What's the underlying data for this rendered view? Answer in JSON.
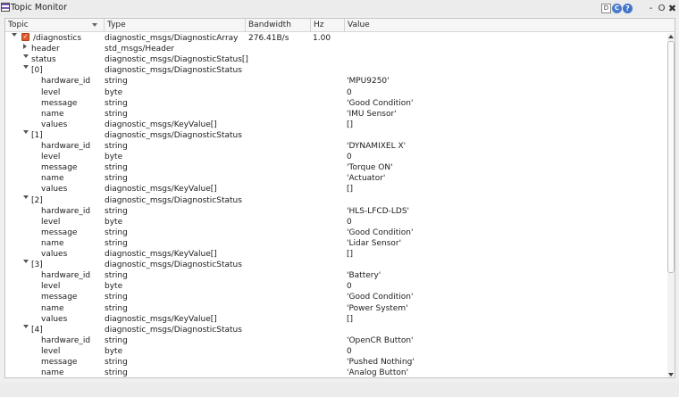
{
  "window": {
    "title": "Topic Monitor",
    "buttons": {
      "d": "D",
      "c": "C",
      "help": "?",
      "minimize": "-",
      "restore": "O",
      "close": "✖"
    }
  },
  "columns": {
    "topic": "Topic",
    "type": "Type",
    "bandwidth": "Bandwidth",
    "hz": "Hz",
    "value": "Value"
  },
  "rows": [
    {
      "depth": 0,
      "expander": "down",
      "checked": true,
      "label": "/diagnostics",
      "type": "diagnostic_msgs/DiagnosticArray",
      "bandwidth": "276.41B/s",
      "hz": "1.00",
      "value": ""
    },
    {
      "depth": 1,
      "expander": "right",
      "label": "header",
      "type": "std_msgs/Header",
      "value": ""
    },
    {
      "depth": 1,
      "expander": "down",
      "label": "status",
      "type": "diagnostic_msgs/DiagnosticStatus[]",
      "value": ""
    },
    {
      "depth": 2,
      "expander": "down",
      "label": "[0]",
      "type": "diagnostic_msgs/DiagnosticStatus",
      "value": ""
    },
    {
      "depth": 3,
      "label": "hardware_id",
      "type": "string",
      "value": "'MPU9250'"
    },
    {
      "depth": 3,
      "label": "level",
      "type": "byte",
      "value": "0"
    },
    {
      "depth": 3,
      "label": "message",
      "type": "string",
      "value": "'Good Condition'"
    },
    {
      "depth": 3,
      "label": "name",
      "type": "string",
      "value": "'IMU Sensor'"
    },
    {
      "depth": 3,
      "label": "values",
      "type": "diagnostic_msgs/KeyValue[]",
      "value": "[]"
    },
    {
      "depth": 2,
      "expander": "down",
      "label": "[1]",
      "type": "diagnostic_msgs/DiagnosticStatus",
      "value": ""
    },
    {
      "depth": 3,
      "label": "hardware_id",
      "type": "string",
      "value": "'DYNAMIXEL X'"
    },
    {
      "depth": 3,
      "label": "level",
      "type": "byte",
      "value": "0"
    },
    {
      "depth": 3,
      "label": "message",
      "type": "string",
      "value": "'Torque ON'"
    },
    {
      "depth": 3,
      "label": "name",
      "type": "string",
      "value": "'Actuator'"
    },
    {
      "depth": 3,
      "label": "values",
      "type": "diagnostic_msgs/KeyValue[]",
      "value": "[]"
    },
    {
      "depth": 2,
      "expander": "down",
      "label": "[2]",
      "type": "diagnostic_msgs/DiagnosticStatus",
      "value": ""
    },
    {
      "depth": 3,
      "label": "hardware_id",
      "type": "string",
      "value": "'HLS-LFCD-LDS'"
    },
    {
      "depth": 3,
      "label": "level",
      "type": "byte",
      "value": "0"
    },
    {
      "depth": 3,
      "label": "message",
      "type": "string",
      "value": "'Good Condition'"
    },
    {
      "depth": 3,
      "label": "name",
      "type": "string",
      "value": "'Lidar Sensor'"
    },
    {
      "depth": 3,
      "label": "values",
      "type": "diagnostic_msgs/KeyValue[]",
      "value": "[]"
    },
    {
      "depth": 2,
      "expander": "down",
      "label": "[3]",
      "type": "diagnostic_msgs/DiagnosticStatus",
      "value": ""
    },
    {
      "depth": 3,
      "label": "hardware_id",
      "type": "string",
      "value": "'Battery'"
    },
    {
      "depth": 3,
      "label": "level",
      "type": "byte",
      "value": "0"
    },
    {
      "depth": 3,
      "label": "message",
      "type": "string",
      "value": "'Good Condition'"
    },
    {
      "depth": 3,
      "label": "name",
      "type": "string",
      "value": "'Power System'"
    },
    {
      "depth": 3,
      "label": "values",
      "type": "diagnostic_msgs/KeyValue[]",
      "value": "[]"
    },
    {
      "depth": 2,
      "expander": "down",
      "label": "[4]",
      "type": "diagnostic_msgs/DiagnosticStatus",
      "value": ""
    },
    {
      "depth": 3,
      "label": "hardware_id",
      "type": "string",
      "value": "'OpenCR Button'"
    },
    {
      "depth": 3,
      "label": "level",
      "type": "byte",
      "value": "0"
    },
    {
      "depth": 3,
      "label": "message",
      "type": "string",
      "value": "'Pushed Nothing'"
    },
    {
      "depth": 3,
      "label": "name",
      "type": "string",
      "value": "'Analog Button'"
    }
  ]
}
